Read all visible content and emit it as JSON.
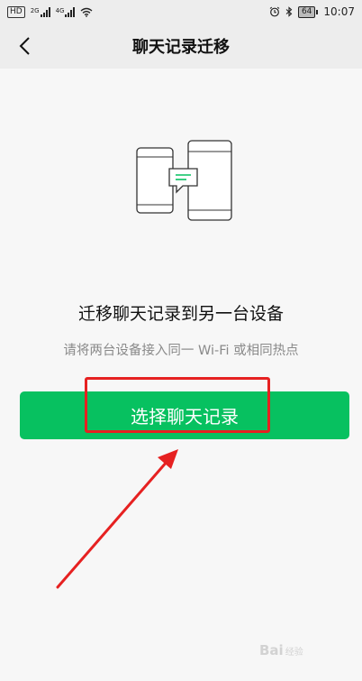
{
  "status_bar": {
    "hd": "HD",
    "net1": "2G",
    "net2": "4G",
    "battery": "64",
    "time": "10:07"
  },
  "nav": {
    "title": "聊天记录迁移",
    "back_icon": "chevron-left-icon"
  },
  "main": {
    "illustration_icon": "phones-transfer-icon",
    "headline": "迁移聊天记录到另一台设备",
    "subtitle": "请将两台设备接入同一 Wi-Fi 或相同热点",
    "select_button_label": "选择聊天记录"
  },
  "watermark": {
    "brand": "Bai",
    "suffix": "经验"
  },
  "colors": {
    "accent": "#07c160",
    "annotation": "#e62121"
  }
}
